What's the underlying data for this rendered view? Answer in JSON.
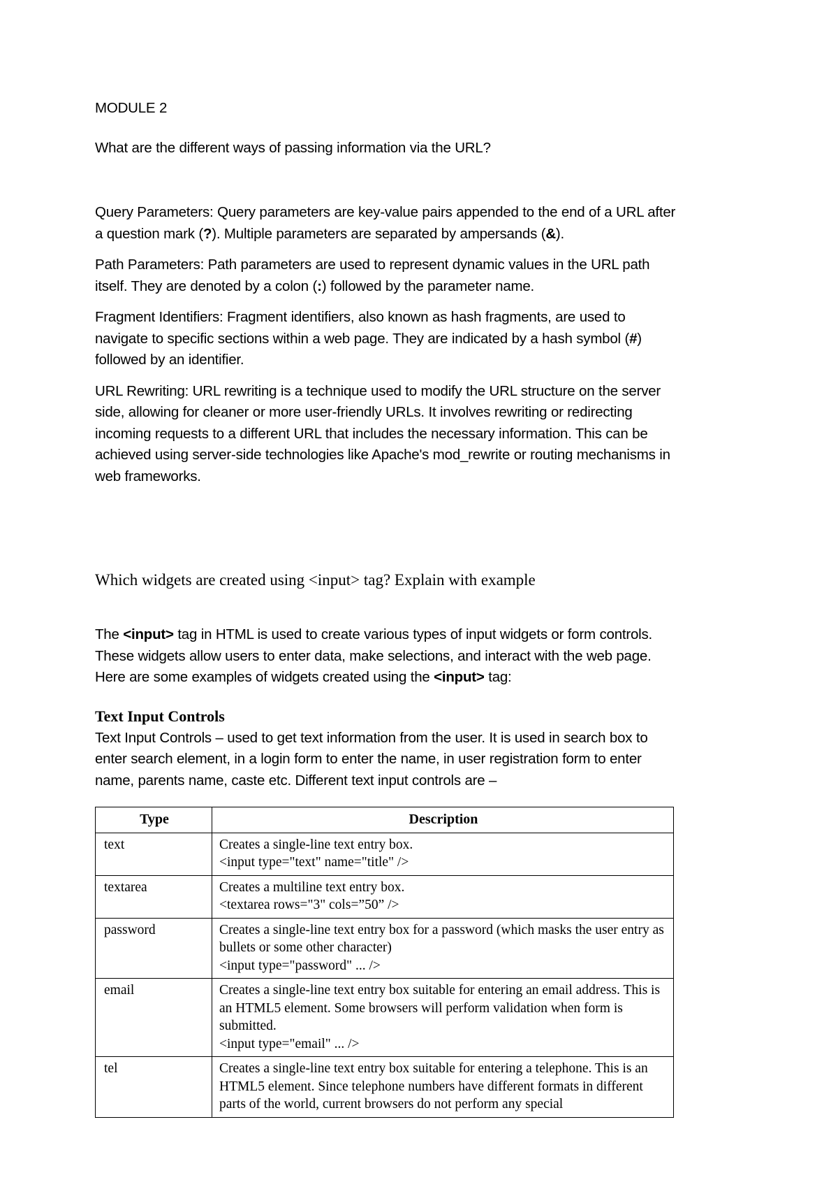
{
  "document": {
    "module_title": "MODULE 2",
    "question_1": "What are the different ways of passing information via the URL?",
    "paragraphs": {
      "query_params_a": "Query Parameters: Query parameters are key-value pairs appended to the end of a URL after a question mark (",
      "query_params_b": "?",
      "query_params_c": "). Multiple parameters are separated by ampersands (",
      "query_params_d": "&",
      "query_params_e": ").",
      "path_params_a": "Path Parameters: Path parameters are used to represent dynamic values in the URL path itself. They are denoted by a colon (",
      "path_params_b": ":",
      "path_params_c": ") followed by the parameter name.",
      "fragment_a": "Fragment Identifiers: Fragment identifiers, also known as hash fragments, are used to navigate to specific sections within a web page. They are indicated by a hash symbol (",
      "fragment_b": "#",
      "fragment_c": ") followed by an identifier.",
      "rewriting": "URL Rewriting: URL rewriting is a technique used to modify the URL structure on the server side, allowing for cleaner or more user-friendly URLs. It involves rewriting or redirecting incoming requests to a different URL that includes the necessary information. This can be achieved using server-side technologies like Apache's mod_rewrite or routing mechanisms in web frameworks."
    },
    "question_2": "Which widgets are created using <input> tag? Explain with example",
    "intro": {
      "a": "The ",
      "b": "<input>",
      "c": " tag in HTML is used to create various types of input widgets or form controls. These widgets allow users to enter data, make selections, and interact with the web page. Here are some examples of widgets created using the ",
      "d": "<input>",
      "e": " tag:"
    },
    "section_heading": "Text Input Controls",
    "section_body": "Text Input Controls – used to get text information from the user. It is used in search box to enter search element, in a login form to enter the name, in user registration form to enter name, parents name, caste etc. Different text input controls are –",
    "table": {
      "headers": [
        "Type",
        "Description"
      ],
      "rows": [
        {
          "type": "text",
          "lines": [
            "Creates a single-line text entry box.",
            "<input type=\"text\" name=\"title\" />"
          ]
        },
        {
          "type": "textarea",
          "lines": [
            "Creates a multiline text entry box.",
            "<textarea rows=\"3\" cols=”50” />"
          ]
        },
        {
          "type": "password",
          "lines": [
            "Creates a single-line text entry box for a password (which masks the user entry as bullets or some other character)",
            "<input type=\"password\" ... />"
          ]
        },
        {
          "type": "email",
          "lines": [
            "Creates a single-line text entry box suitable for entering an email address. This is an HTML5 element. Some browsers will perform validation when form is submitted.",
            "<input type=\"email\" ... />"
          ]
        },
        {
          "type": "tel",
          "lines": [
            "Creates a single-line text entry box suitable for entering a telephone. This is an HTML5 element. Since telephone numbers have different formats in different parts of the world, current browsers do not perform any special"
          ]
        }
      ]
    }
  }
}
